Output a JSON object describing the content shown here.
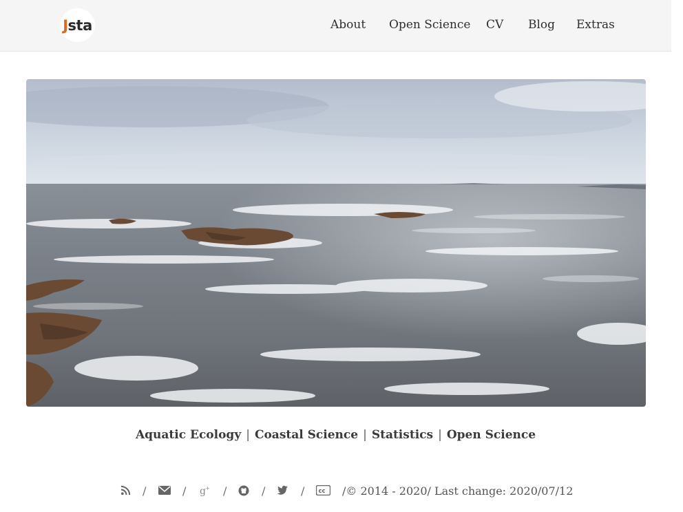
{
  "logo": {
    "initial": "J",
    "rest": "sta"
  },
  "nav": {
    "items": [
      {
        "label": "About"
      },
      {
        "label": "Open Science"
      },
      {
        "label": "CV"
      },
      {
        "label": "Blog"
      },
      {
        "label": "Extras"
      }
    ]
  },
  "tags": [
    "Aquatic Ecology",
    "Coastal Science",
    "Statistics",
    "Open Science"
  ],
  "footer": {
    "icons": [
      "rss-icon",
      "envelope-icon",
      "google-plus-icon",
      "github-icon",
      "twitter-icon",
      "creative-commons-icon"
    ],
    "separator": "/",
    "copyright": "/© 2014 - 2020/ Last change: 2020/07/12"
  }
}
